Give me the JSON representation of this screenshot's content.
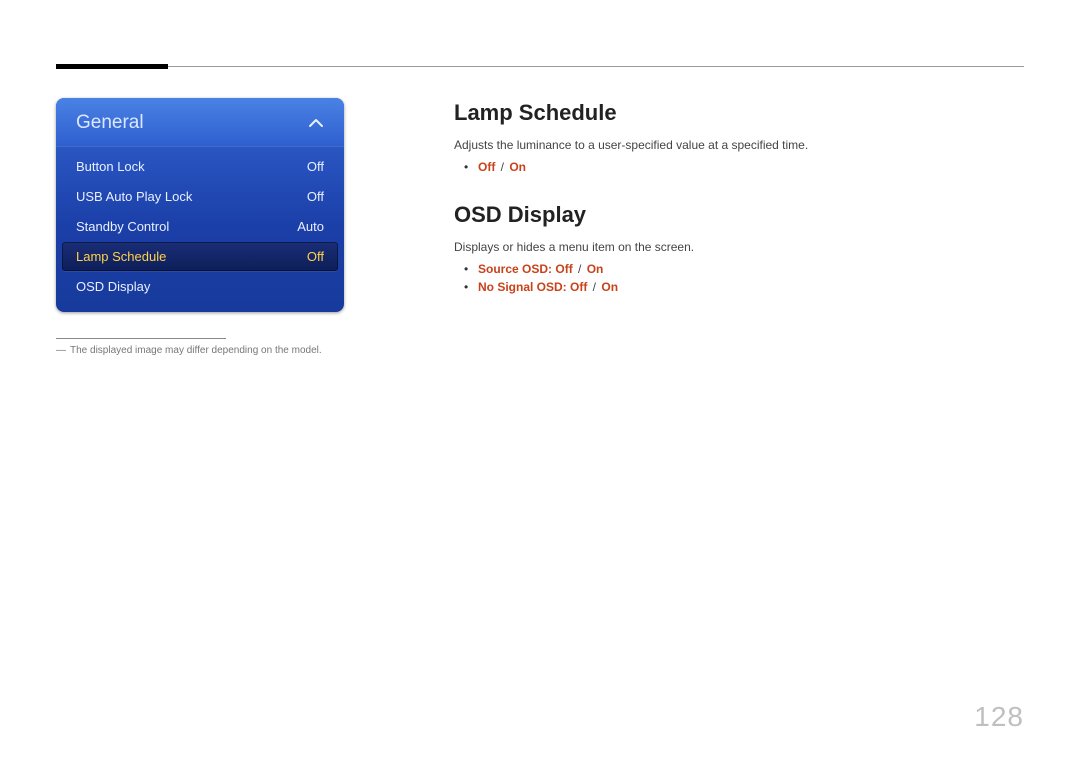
{
  "osd": {
    "title": "General",
    "items": [
      {
        "label": "Button Lock",
        "value": "Off",
        "selected": false
      },
      {
        "label": "USB Auto Play Lock",
        "value": "Off",
        "selected": false
      },
      {
        "label": "Standby Control",
        "value": "Auto",
        "selected": false
      },
      {
        "label": "Lamp Schedule",
        "value": "Off",
        "selected": true
      },
      {
        "label": "OSD Display",
        "value": "",
        "selected": false
      }
    ]
  },
  "footnote": {
    "dash": "―",
    "text": "The displayed image may differ depending on the model."
  },
  "sections": [
    {
      "heading": "Lamp Schedule",
      "desc": "Adjusts the luminance to a user-specified value at a specified time.",
      "options": [
        {
          "prefix": "",
          "a": "Off",
          "sep": " / ",
          "b": "On"
        }
      ]
    },
    {
      "heading": "OSD Display",
      "desc": "Displays or hides a menu item on the screen.",
      "options": [
        {
          "prefix": "Source OSD: ",
          "a": "Off",
          "sep": " / ",
          "b": "On"
        },
        {
          "prefix": "No Signal OSD: ",
          "a": "Off",
          "sep": " / ",
          "b": "On"
        }
      ]
    }
  ],
  "page_number": "128"
}
